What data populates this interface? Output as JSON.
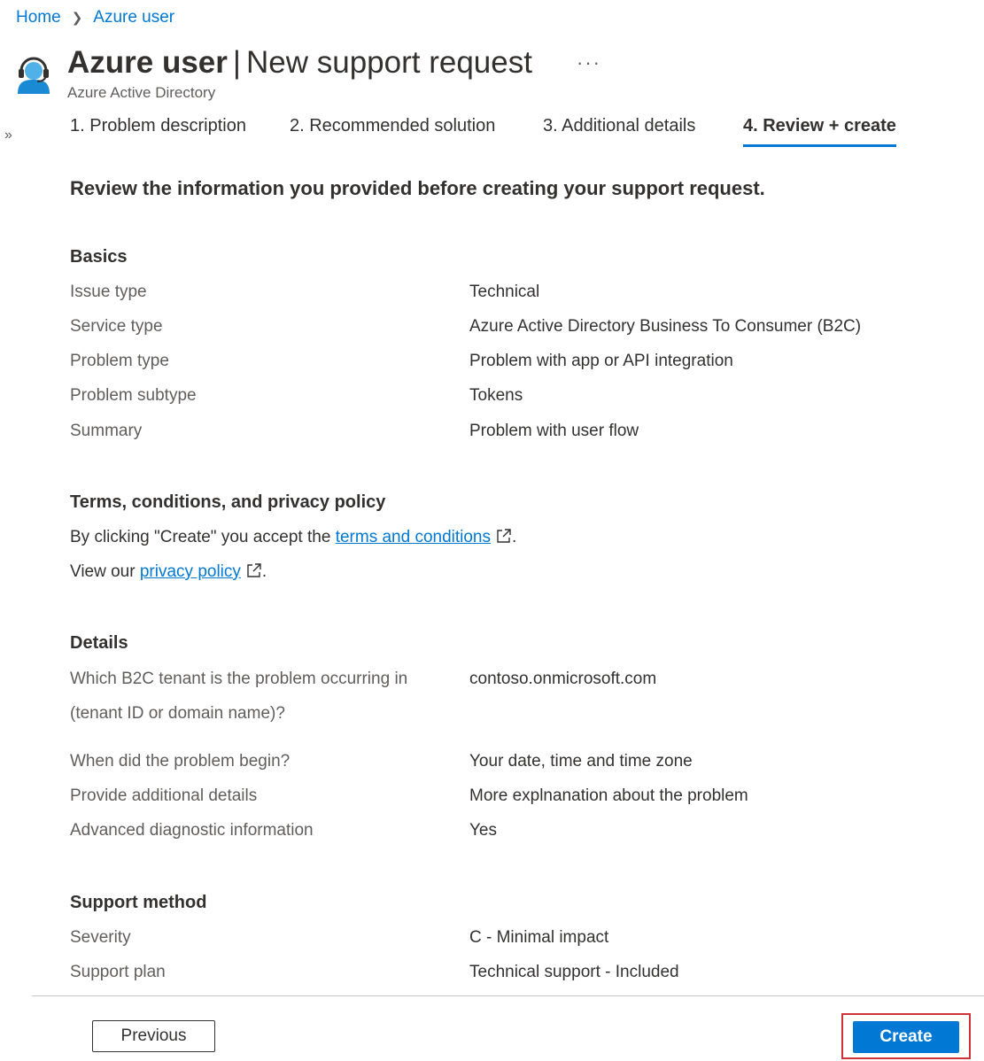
{
  "breadcrumb": {
    "home": "Home",
    "current": "Azure user"
  },
  "header": {
    "title_strong": "Azure user",
    "title_separator": "|",
    "title_rest": "New support request",
    "more": "···",
    "subtitle": "Azure Active Directory"
  },
  "expand_glyph": "»",
  "tabs": [
    {
      "label": "1. Problem description",
      "active": false
    },
    {
      "label": "2. Recommended solution",
      "active": false
    },
    {
      "label": "3. Additional details",
      "active": false
    },
    {
      "label": "4. Review + create",
      "active": true
    }
  ],
  "intro": "Review the information you provided before creating your support request.",
  "basics": {
    "title": "Basics",
    "rows": [
      {
        "label": "Issue type",
        "value": "Technical"
      },
      {
        "label": "Service type",
        "value": "Azure Active Directory Business To Consumer (B2C)"
      },
      {
        "label": "Problem type",
        "value": "Problem with app or API integration"
      },
      {
        "label": "Problem subtype",
        "value": "Tokens"
      },
      {
        "label": "Summary",
        "value": "Problem with user flow"
      }
    ]
  },
  "terms": {
    "title": "Terms, conditions, and privacy policy",
    "line1_prefix": "By clicking \"Create\" you accept the ",
    "line1_link": "terms and conditions",
    "line1_suffix": ".",
    "line2_prefix": "View our ",
    "line2_link": "privacy policy",
    "line2_suffix": "."
  },
  "details": {
    "title": "Details",
    "tenant_label_line1": "Which B2C tenant is the problem occurring in",
    "tenant_label_line2": "(tenant ID or domain name)?",
    "tenant_value": "contoso.onmicrosoft.com",
    "rows": [
      {
        "label": "When did the problem begin?",
        "value": "Your date, time and time zone"
      },
      {
        "label": "Provide additional details",
        "value": "More explnanation about the problem"
      },
      {
        "label": "Advanced diagnostic information",
        "value": "Yes"
      }
    ]
  },
  "support_method": {
    "title": "Support method",
    "rows": [
      {
        "label": "Severity",
        "value": "C - Minimal impact"
      },
      {
        "label": "Support plan",
        "value": "Technical support - Included"
      }
    ]
  },
  "footer": {
    "previous": "Previous",
    "create": "Create"
  },
  "colors": {
    "accent": "#0078d4",
    "highlight": "#d13438",
    "text": "#323130",
    "muted": "#605e5c"
  }
}
